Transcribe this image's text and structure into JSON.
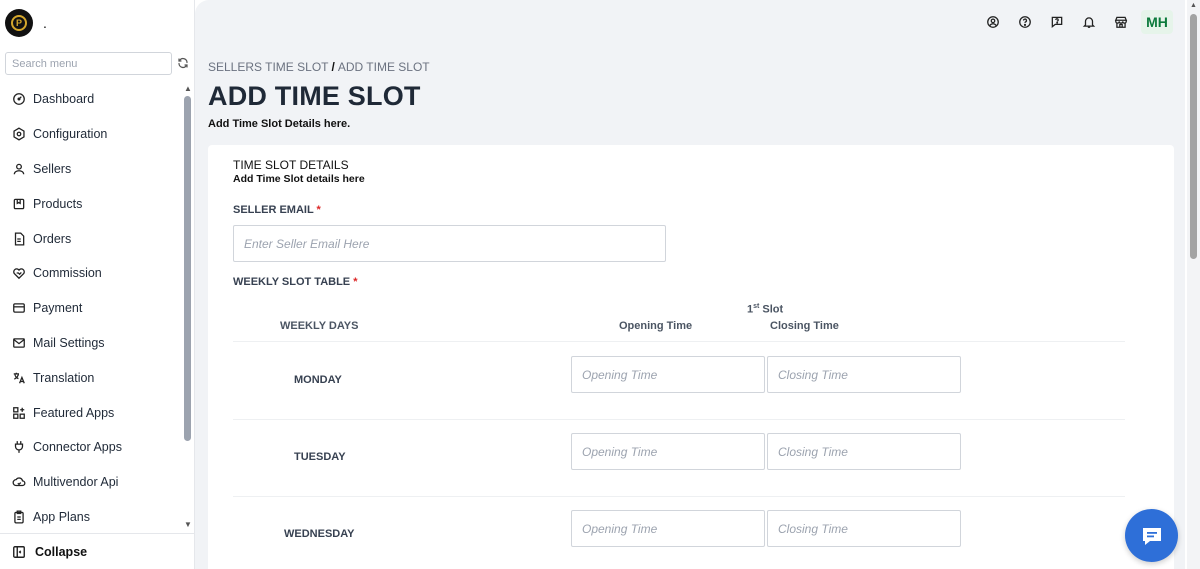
{
  "sidebar": {
    "shop_name": ".",
    "search_placeholder": "Search menu",
    "items": [
      {
        "label": "Dashboard",
        "icon": "dashboard-icon"
      },
      {
        "label": "Configuration",
        "icon": "settings-icon"
      },
      {
        "label": "Sellers",
        "icon": "user-icon"
      },
      {
        "label": "Products",
        "icon": "product-icon"
      },
      {
        "label": "Orders",
        "icon": "orders-icon"
      },
      {
        "label": "Commission",
        "icon": "commission-icon"
      },
      {
        "label": "Payment",
        "icon": "payment-icon"
      },
      {
        "label": "Mail Settings",
        "icon": "mail-icon"
      },
      {
        "label": "Translation",
        "icon": "translation-icon"
      },
      {
        "label": "Featured Apps",
        "icon": "apps-icon"
      },
      {
        "label": "Connector Apps",
        "icon": "plug-icon"
      },
      {
        "label": "Multivendor Api",
        "icon": "cloud-icon"
      },
      {
        "label": "App Plans",
        "icon": "plans-icon"
      }
    ],
    "collapse_label": "Collapse"
  },
  "topbar": {
    "avatar_initials": "MH"
  },
  "breadcrumb": {
    "parent": "SELLERS TIME SLOT",
    "separator": "/",
    "current": "ADD TIME SLOT"
  },
  "page": {
    "title": "ADD TIME SLOT",
    "subtitle": "Add Time Slot Details here."
  },
  "card": {
    "title": "TIME SLOT DETAILS",
    "subtitle": "Add Time Slot details here",
    "seller_email_label": "SELLER EMAIL",
    "seller_email_placeholder": "Enter Seller Email Here",
    "required_mark": "*",
    "weekly_label": "WEEKLY SLOT TABLE",
    "table": {
      "slot_header_num": "1",
      "slot_header_sup": "st",
      "slot_header_text": " Slot",
      "days_header": "WEEKLY DAYS",
      "opening_header": "Opening Time",
      "closing_header": "Closing Time",
      "opening_placeholder": "Opening Time",
      "closing_placeholder": "Closing Time",
      "days": [
        "MONDAY",
        "TUESDAY",
        "WEDNESDAY"
      ]
    }
  }
}
